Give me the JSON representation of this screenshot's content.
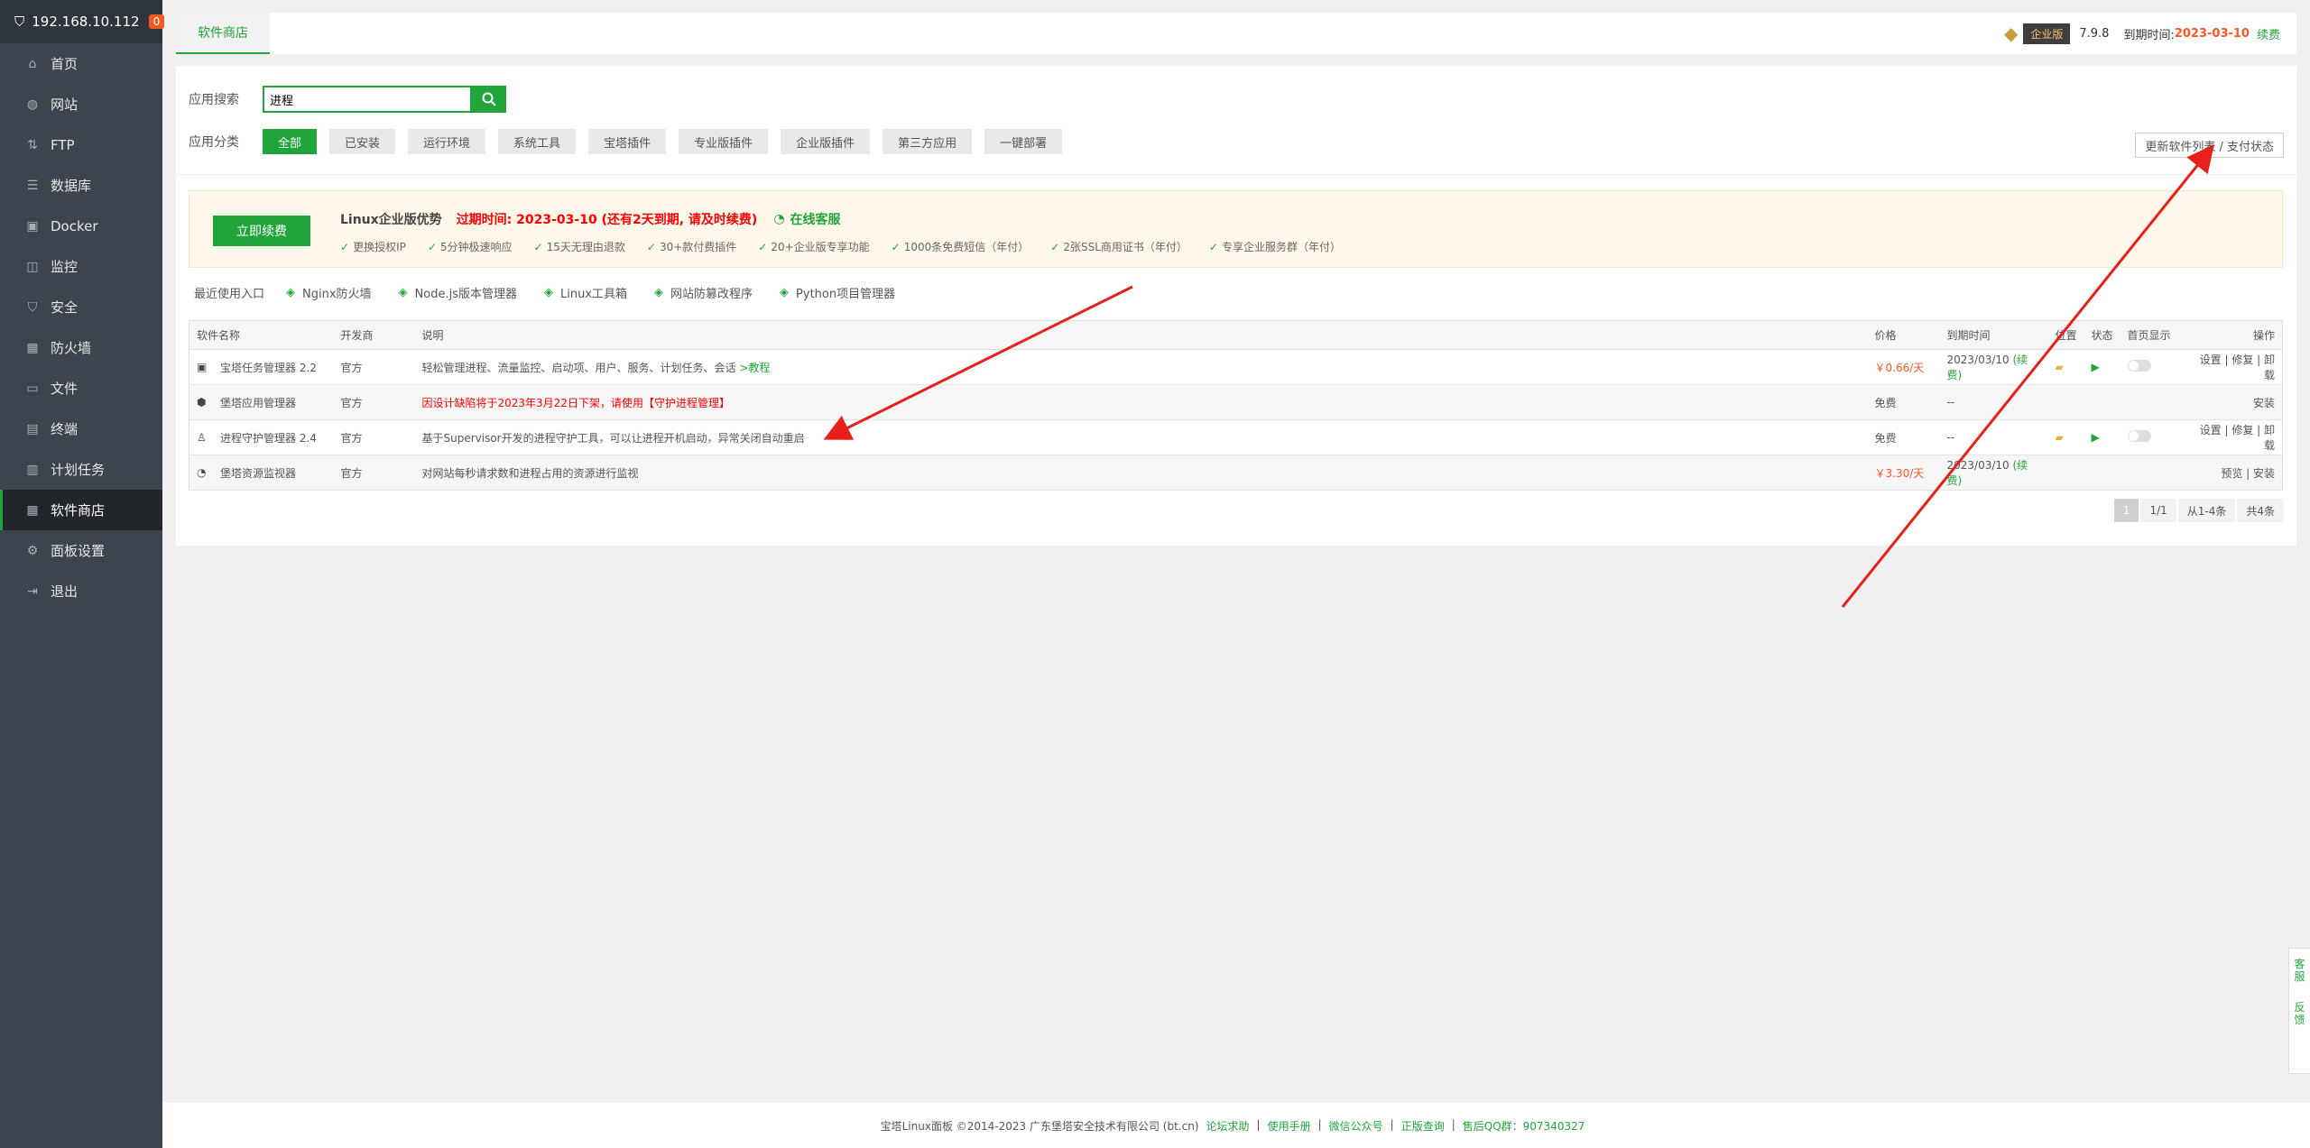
{
  "sidebar": {
    "ip": "192.168.10.112",
    "badge": "0",
    "items": [
      {
        "label": "首页",
        "icon": "home-icon"
      },
      {
        "label": "网站",
        "icon": "globe-icon"
      },
      {
        "label": "FTP",
        "icon": "ftp-icon"
      },
      {
        "label": "数据库",
        "icon": "database-icon"
      },
      {
        "label": "Docker",
        "icon": "docker-icon"
      },
      {
        "label": "监控",
        "icon": "monitor-icon"
      },
      {
        "label": "安全",
        "icon": "shield-icon"
      },
      {
        "label": "防火墙",
        "icon": "firewall-icon"
      },
      {
        "label": "文件",
        "icon": "folder-icon"
      },
      {
        "label": "终端",
        "icon": "terminal-icon"
      },
      {
        "label": "计划任务",
        "icon": "calendar-icon"
      },
      {
        "label": "软件商店",
        "icon": "grid-icon",
        "active": true
      },
      {
        "label": "面板设置",
        "icon": "gear-icon"
      },
      {
        "label": "退出",
        "icon": "logout-icon"
      }
    ]
  },
  "topbar": {
    "tab": "软件商店",
    "edition": "企业版",
    "version": "7.9.8",
    "expire_label": "到期时间:",
    "expire_date": "2023-03-10",
    "renew": "续费"
  },
  "search": {
    "label": "应用搜索",
    "value": "进程"
  },
  "categories": {
    "label": "应用分类",
    "items": [
      "全部",
      "已安装",
      "运行环境",
      "系统工具",
      "宝塔插件",
      "专业版插件",
      "企业版插件",
      "第三方应用",
      "一键部署"
    ]
  },
  "update_button": "更新软件列表 / 支付状态",
  "promo": {
    "renew_button": "立即续费",
    "title": "Linux企业版优势",
    "expire_text": "过期时间: 2023-03-10 (还有2天到期, 请及时续费)",
    "service": "在线客服",
    "features": [
      "更换授权IP",
      "5分钟极速响应",
      "15天无理由退款",
      "30+款付费插件",
      "20+企业版专享功能",
      "1000条免费短信（年付）",
      "2张SSL商用证书（年付）",
      "专享企业服务群（年付）"
    ]
  },
  "recent": {
    "label": "最近使用入口",
    "items": [
      {
        "label": "Nginx防火墙",
        "icon": "nginx-firewall-icon"
      },
      {
        "label": "Node.js版本管理器",
        "icon": "nodejs-icon"
      },
      {
        "label": "Linux工具箱",
        "icon": "toolbox-icon"
      },
      {
        "label": "网站防篡改程序",
        "icon": "tamper-proof-icon"
      },
      {
        "label": "Python项目管理器",
        "icon": "python-icon"
      }
    ]
  },
  "table": {
    "headers": [
      "软件名称",
      "开发商",
      "说明",
      "价格",
      "到期时间",
      "位置",
      "状态",
      "首页显示",
      "操作"
    ],
    "rows": [
      {
        "name": "宝塔任务管理器 2.2",
        "vendor": "官方",
        "desc": "轻松管理进程、流量监控、启动项、用户、服务、计划任务、会话",
        "desc_link": ">教程",
        "price": "￥0.66/天",
        "expire": "2023/03/10",
        "expire_link": "(续费)",
        "has_controls": true,
        "ops": "设置 | 修复 | 卸载"
      },
      {
        "name": "堡塔应用管理器",
        "vendor": "官方",
        "desc_warn": "因设计缺陷将于2023年3月22日下架，请使用【守护进程管理】",
        "price": "免费",
        "expire": "--",
        "has_controls": false,
        "ops": "安装"
      },
      {
        "name": "进程守护管理器 2.4",
        "vendor": "官方",
        "desc": "基于Supervisor开发的进程守护工具，可以让进程开机启动，异常关闭自动重启",
        "price": "免费",
        "expire": "--",
        "has_controls": true,
        "ops": "设置 | 修复 | 卸载"
      },
      {
        "name": "堡塔资源监视器",
        "vendor": "官方",
        "desc": "对网站每秒请求数和进程占用的资源进行监视",
        "price": "￥3.30/天",
        "expire": "2023/03/10",
        "expire_link": "(续费)",
        "has_controls": false,
        "ops": "预览 | 安装"
      }
    ]
  },
  "pager": {
    "current": "1",
    "pages": "1/1",
    "range": "从1-4条",
    "total": "共4条"
  },
  "footer": {
    "copyright": "宝塔Linux面板 ©2014-2023 广东堡塔安全技术有限公司 (bt.cn)",
    "links": [
      "论坛求助",
      "使用手册",
      "微信公众号",
      "正版查询"
    ],
    "qq": "售后QQ群：907340327"
  },
  "float": {
    "service": "客服",
    "feedback": "反馈"
  }
}
